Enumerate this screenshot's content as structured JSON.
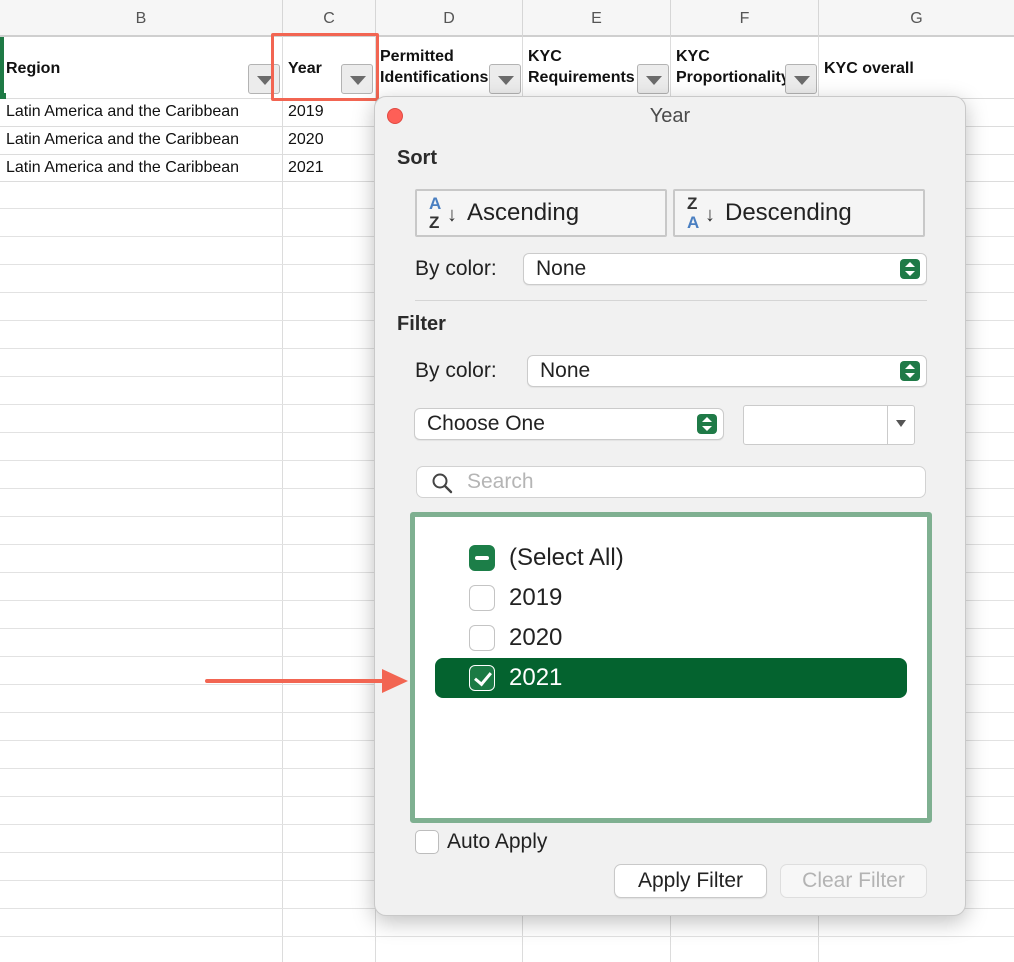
{
  "sheet": {
    "column_letters": [
      "B",
      "C",
      "D",
      "E",
      "F",
      "G"
    ],
    "headers": {
      "region": "Region",
      "year": "Year",
      "permitted_line1": "Permitted",
      "permitted_line2": "Identifications",
      "kyc_req_line1": "KYC",
      "kyc_req_line2": "Requirements",
      "kyc_prop_line1": "KYC",
      "kyc_prop_line2": "Proportionality",
      "kyc_overall": "KYC overall"
    },
    "rows": [
      {
        "region": "Latin America and the Caribbean",
        "year": "2019"
      },
      {
        "region": "Latin America and the Caribbean",
        "year": "2020"
      },
      {
        "region": "Latin America and the Caribbean",
        "year": "2021"
      }
    ]
  },
  "popup": {
    "title": "Year",
    "sort": {
      "section_label": "Sort",
      "ascending": {
        "label": "Ascending",
        "glyph_top": "A",
        "glyph_bottom": "Z",
        "glyph_arrow": "↓"
      },
      "descending": {
        "label": "Descending",
        "glyph_top": "Z",
        "glyph_bottom": "A",
        "glyph_arrow": "↓"
      },
      "by_color_label": "By color:",
      "by_color_value": "None"
    },
    "filter": {
      "section_label": "Filter",
      "by_color_label": "By color:",
      "by_color_value": "None",
      "condition_value": "Choose One",
      "search_placeholder": "Search",
      "items": [
        {
          "label": "(Select All)",
          "state": "mixed"
        },
        {
          "label": "2019",
          "state": "unchecked"
        },
        {
          "label": "2020",
          "state": "unchecked"
        },
        {
          "label": "2021",
          "state": "checked"
        }
      ],
      "auto_apply_label": "Auto Apply",
      "apply_button": "Apply Filter",
      "clear_button": "Clear Filter"
    }
  },
  "colors": {
    "accent_green": "#04632f",
    "annotation_red": "#f26552",
    "close_red": "#fe5f57"
  }
}
